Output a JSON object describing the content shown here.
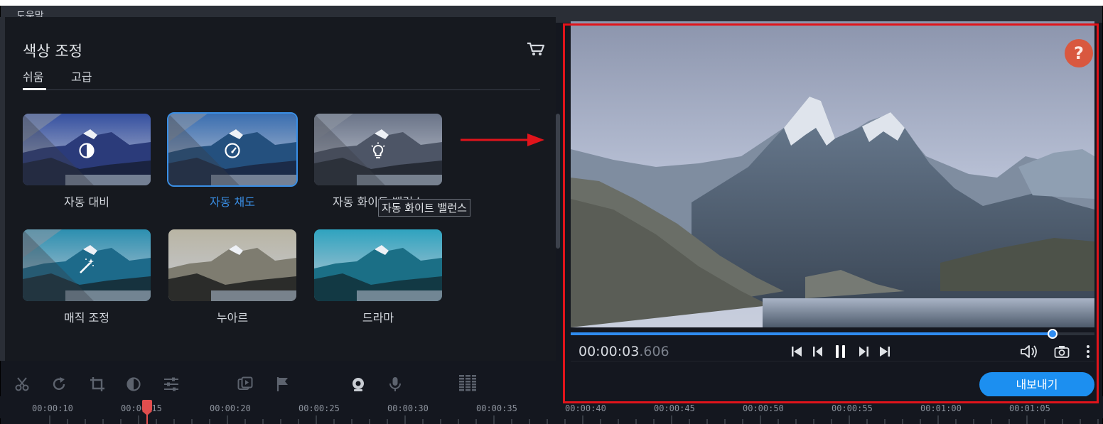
{
  "menu": {
    "help_label": "도움말"
  },
  "panel": {
    "title": "색상 조정",
    "tabs": [
      {
        "label": "쉬움",
        "active": true
      },
      {
        "label": "고급",
        "active": false
      }
    ]
  },
  "presets": [
    {
      "label": "자동 대비",
      "icon": "contrast-icon"
    },
    {
      "label": "자동 채도",
      "icon": "saturation-gauge-icon",
      "selected": true
    },
    {
      "label": "자동 화이트 밸런스",
      "icon": "lightbulb-icon"
    },
    {
      "label": "매직 조정",
      "icon": "magic-wand-icon"
    },
    {
      "label": "누아르",
      "icon": ""
    },
    {
      "label": "드라마",
      "icon": ""
    }
  ],
  "tooltip": "자동 화이트 밸런스",
  "player": {
    "time_main": "00:00:03",
    "time_ms": ".606",
    "progress": 0.92,
    "help_symbol": "?"
  },
  "export_label": "내보내기",
  "timeline": {
    "ticks": [
      "00:00:10",
      "00:00:15",
      "00:00:20",
      "00:00:25",
      "00:00:30",
      "00:00:35",
      "00:00:40",
      "00:00:45",
      "00:00:50",
      "00:00:55",
      "00:01:00",
      "00:01:05"
    ]
  },
  "colors": {
    "accent": "#1c8ff0",
    "annotation": "#e0141b",
    "help": "#d9583f"
  }
}
